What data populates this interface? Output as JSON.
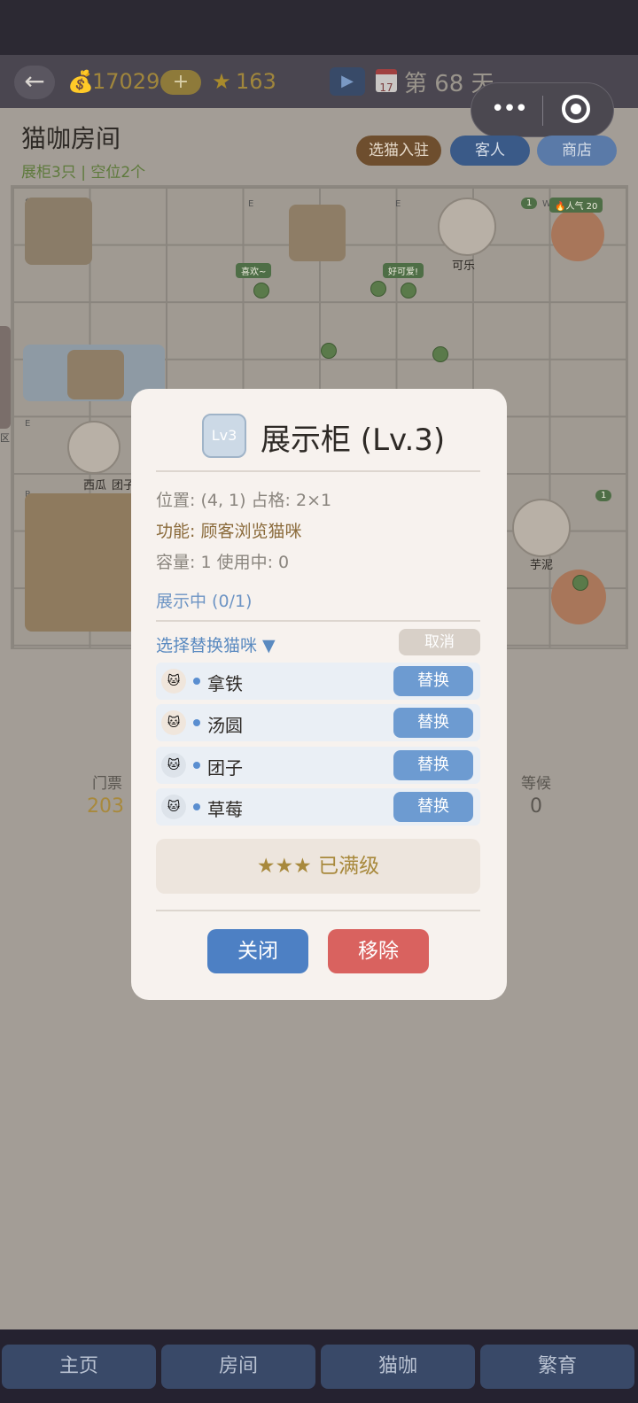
{
  "header": {
    "back_icon": "arrow-left-icon",
    "coins": "17029",
    "plus": "+",
    "stars": "163",
    "day": "第 68 天",
    "calendar_number": "17",
    "capsule_more": "•••"
  },
  "room": {
    "title": "猫咖房间",
    "subtitle": "展柜3只 | 空位2个",
    "buttons": {
      "select_cat": "选猫入驻",
      "guests": "客人",
      "shop": "商店"
    }
  },
  "map": {
    "cats": [
      {
        "name": "可乐"
      },
      {
        "name": "西瓜"
      },
      {
        "name": "团子"
      },
      {
        "name": "芋泥"
      }
    ],
    "popularity": "🔥人气 20",
    "badge_1": "1",
    "badge_2": "1",
    "bubble_1": "喜欢~",
    "bubble_2": "好可爱!",
    "left_edge_label": "区",
    "tile_labels": [
      "$",
      "E",
      "E",
      "W",
      "E",
      "E",
      "P"
    ]
  },
  "stats": {
    "ticket_label": "门票",
    "ticket_value": "203",
    "waiting_label": "等候",
    "waiting_value": "0"
  },
  "modal": {
    "level_badge": "Lv3",
    "title": "展示柜 (Lv.3)",
    "position": "位置: (4, 1)  占格: 2×1",
    "function": "功能: 顾客浏览猫咪",
    "capacity": "容量: 1  使用中: 0",
    "displaying": "展示中 (0/1)",
    "select_replace": "选择替换猫咪 ▼",
    "cancel": "取消",
    "cats": [
      {
        "name": "拿铁",
        "button": "替换"
      },
      {
        "name": "汤圆",
        "button": "替换"
      },
      {
        "name": "团子",
        "button": "替换"
      },
      {
        "name": "草莓",
        "button": "替换"
      }
    ],
    "max_level": "★★★ 已满级",
    "close": "关闭",
    "remove": "移除"
  },
  "tabs": [
    "主页",
    "房间",
    "猫咖",
    "繁育"
  ],
  "colors": {
    "accent_blue": "#4d80c4",
    "danger_red": "#d9625f",
    "gold": "#a8893c"
  }
}
